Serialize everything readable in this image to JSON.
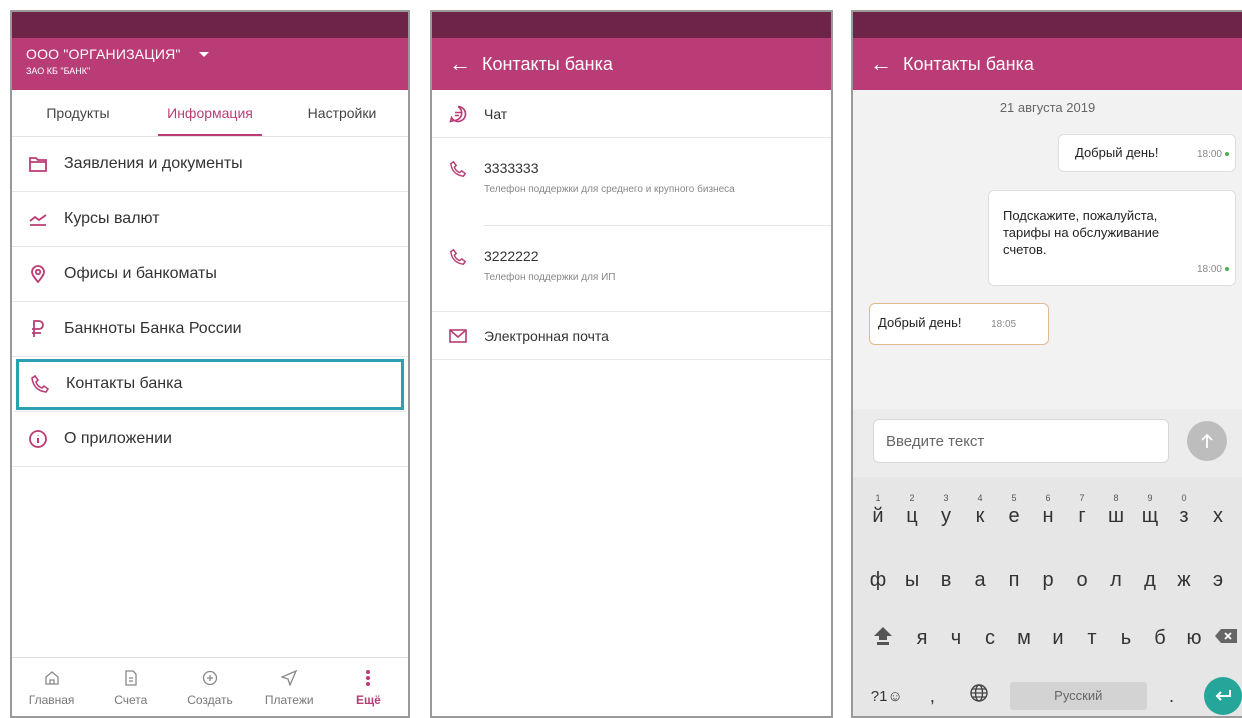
{
  "panel1": {
    "org_name": "ООО \"ОРГАНИЗАЦИЯ\"",
    "bank_name": "ЗАО КБ \"БАНК\"",
    "tabs": [
      "Продукты",
      "Информация",
      "Настройки"
    ],
    "active_tab": "Информация",
    "menu": [
      {
        "label": "Заявления и документы",
        "icon": "folder-icon"
      },
      {
        "label": "Курсы валют",
        "icon": "chart-icon"
      },
      {
        "label": "Офисы и банкоматы",
        "icon": "location-pin-icon"
      },
      {
        "label": "Банкноты Банка России",
        "icon": "ruble-icon"
      },
      {
        "label": "Контакты банка",
        "icon": "phone-icon"
      },
      {
        "label": "О приложении",
        "icon": "info-icon"
      }
    ],
    "bottom_nav": [
      {
        "label": "Главная",
        "icon": "home-icon"
      },
      {
        "label": "Счета",
        "icon": "document-icon"
      },
      {
        "label": "Создать",
        "icon": "plus-circle-icon"
      },
      {
        "label": "Платежи",
        "icon": "send-icon"
      },
      {
        "label": "Ещё",
        "icon": "more-vertical-icon"
      }
    ]
  },
  "panel2": {
    "title": "Контакты банка",
    "contacts": [
      {
        "label": "Чат",
        "icon": "chat-icon"
      },
      {
        "label": "3333333",
        "sub": "Телефон поддержки для среднего и крупного бизнеса",
        "icon": "phone-icon"
      },
      {
        "label": "3222222",
        "sub": "Телефон поддержки для ИП",
        "icon": "phone-icon"
      },
      {
        "label": "Электронная почта",
        "icon": "mail-icon"
      }
    ]
  },
  "panel3": {
    "title": "Контакты банка",
    "date": "21 августа 2019",
    "messages": [
      {
        "text": "Добрый день!",
        "time": "18:00"
      },
      {
        "text": "Подскажите, пожалуйста, тарифы на обслуживание счетов.",
        "time": "18:00"
      },
      {
        "text": "Добрый день!",
        "time": "18:05"
      }
    ],
    "input_placeholder": "Введите текст",
    "keyboard": {
      "row1": [
        "й",
        "ц",
        "у",
        "к",
        "е",
        "н",
        "г",
        "ш",
        "щ",
        "з",
        "х"
      ],
      "row1_nums": [
        "1",
        "2",
        "3",
        "4",
        "5",
        "6",
        "7",
        "8",
        "9",
        "0",
        ""
      ],
      "row2": [
        "ф",
        "ы",
        "в",
        "а",
        "п",
        "р",
        "о",
        "л",
        "д",
        "ж",
        "э"
      ],
      "row3": [
        "я",
        "ч",
        "с",
        "м",
        "и",
        "т",
        "ь",
        "б",
        "ю"
      ],
      "sym_key": "?1☺",
      "comma": ",",
      "space": "Русский",
      "period": "."
    }
  },
  "colors": {
    "brand": "#b93c76",
    "status_bar": "#6e2348",
    "highlight": "#2c9fb0",
    "enter": "#26a69a"
  }
}
